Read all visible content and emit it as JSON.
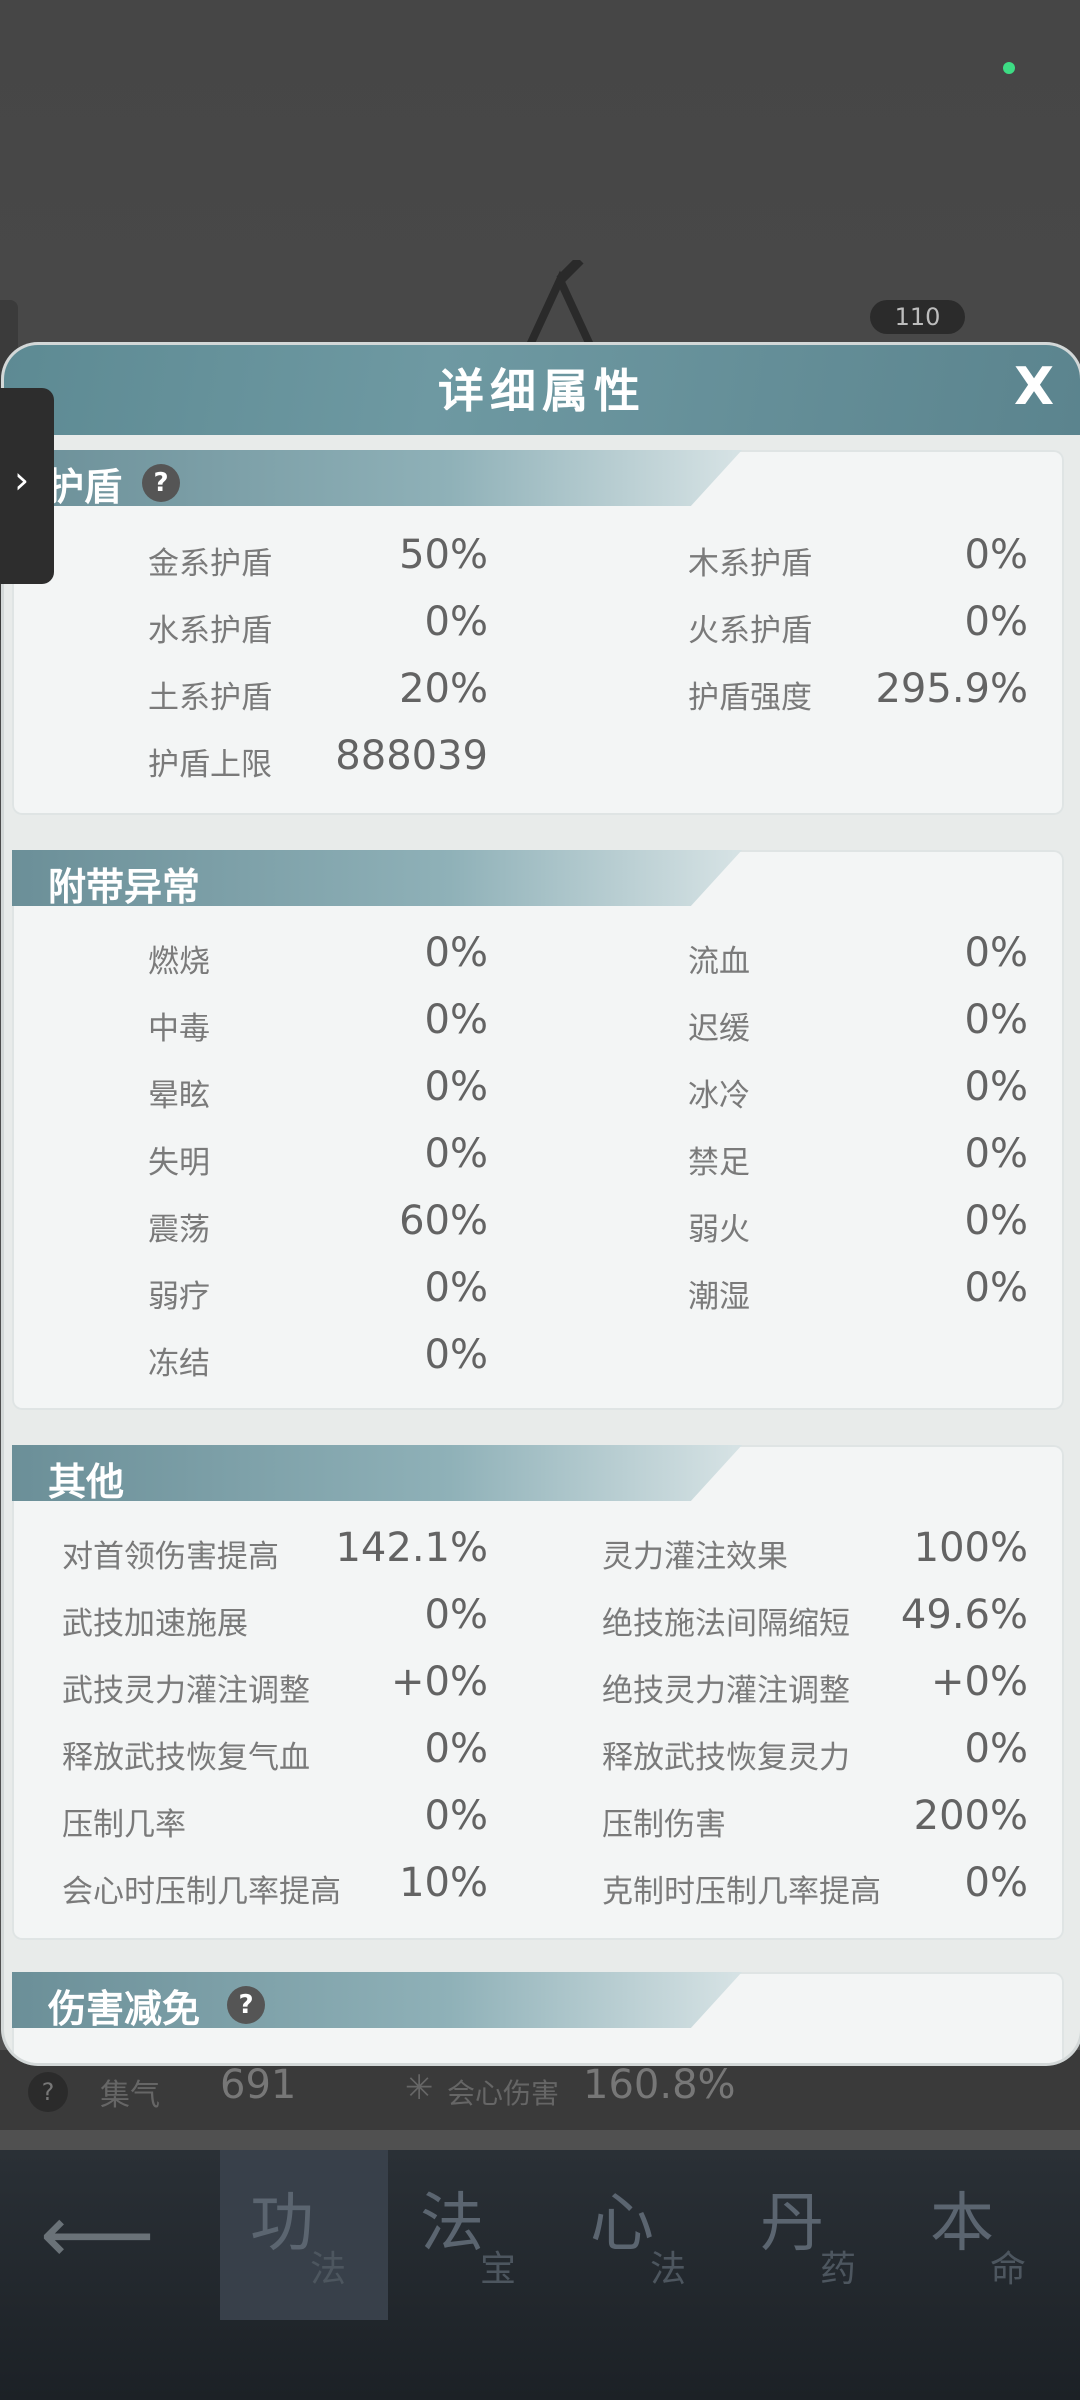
{
  "background": {
    "level_badge": "110",
    "side_tab_icon": "chevron-right-icon"
  },
  "bottom_stats": {
    "qi_label": "集气",
    "qi_value": "691",
    "crit_label": "会心伤害",
    "crit_value": "160.8%"
  },
  "nav": {
    "back_icon": "back-arrow-icon",
    "items": [
      {
        "big": "功",
        "small": "法"
      },
      {
        "big": "法",
        "small": "宝"
      },
      {
        "big": "心",
        "small": "法"
      },
      {
        "big": "丹",
        "small": "药"
      },
      {
        "big": "本",
        "small": "命"
      }
    ]
  },
  "modal": {
    "title": "详细属性",
    "close": "X",
    "sections": {
      "shield": {
        "title": "护盾",
        "help": "?",
        "rows": [
          {
            "label": "金系护盾",
            "value": "50%"
          },
          {
            "label": "木系护盾",
            "value": "0%"
          },
          {
            "label": "水系护盾",
            "value": "0%"
          },
          {
            "label": "火系护盾",
            "value": "0%"
          },
          {
            "label": "土系护盾",
            "value": "20%"
          },
          {
            "label": "护盾强度",
            "value": "295.9%"
          },
          {
            "label": "护盾上限",
            "value": "888039"
          }
        ]
      },
      "status": {
        "title": "附带异常",
        "rows": [
          {
            "label": "燃烧",
            "value": "0%"
          },
          {
            "label": "流血",
            "value": "0%"
          },
          {
            "label": "中毒",
            "value": "0%"
          },
          {
            "label": "迟缓",
            "value": "0%"
          },
          {
            "label": "晕眩",
            "value": "0%"
          },
          {
            "label": "冰冷",
            "value": "0%"
          },
          {
            "label": "失明",
            "value": "0%"
          },
          {
            "label": "禁足",
            "value": "0%"
          },
          {
            "label": "震荡",
            "value": "60%"
          },
          {
            "label": "弱火",
            "value": "0%"
          },
          {
            "label": "弱疗",
            "value": "0%"
          },
          {
            "label": "潮湿",
            "value": "0%"
          },
          {
            "label": "冻结",
            "value": "0%"
          }
        ]
      },
      "other": {
        "title": "其他",
        "rows": [
          {
            "label": "对首领伤害提高",
            "value": "142.1%"
          },
          {
            "label": "灵力灌注效果",
            "value": "100%"
          },
          {
            "label": "武技加速施展",
            "value": "0%"
          },
          {
            "label": "绝技施法间隔缩短",
            "value": "49.6%"
          },
          {
            "label": "武技灵力灌注调整",
            "value": "+0%"
          },
          {
            "label": "绝技灵力灌注调整",
            "value": "+0%"
          },
          {
            "label": "释放武技恢复气血",
            "value": "0%"
          },
          {
            "label": "释放武技恢复灵力",
            "value": "0%"
          },
          {
            "label": "压制几率",
            "value": "0%"
          },
          {
            "label": "压制伤害",
            "value": "200%"
          },
          {
            "label": "会心时压制几率提高",
            "value": "10%"
          },
          {
            "label": "克制时压制几率提高",
            "value": "0%"
          }
        ]
      },
      "damage_reduction": {
        "title": "伤害减免",
        "help": "?"
      }
    }
  }
}
